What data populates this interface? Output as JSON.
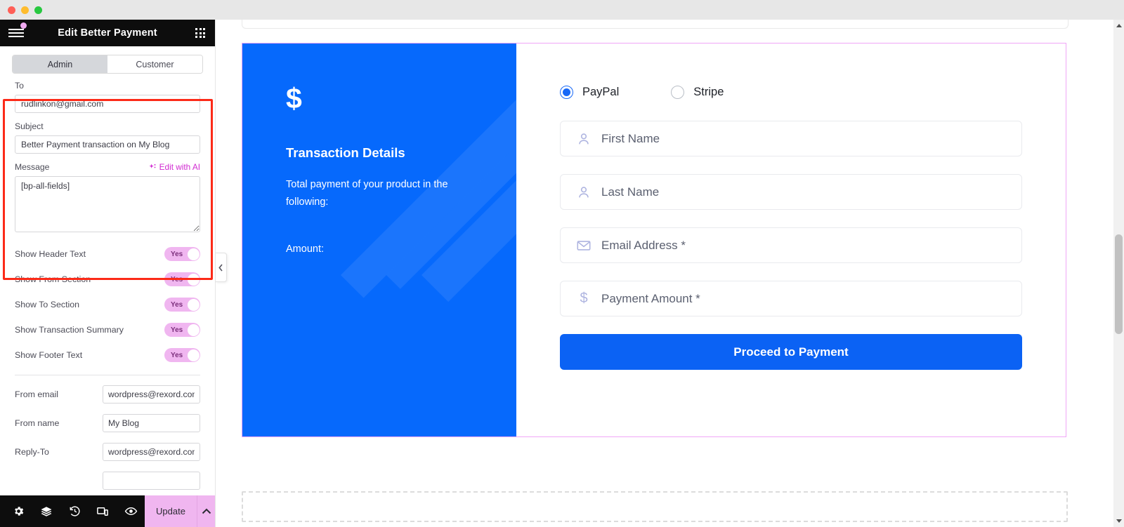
{
  "window": {
    "traffic_lights": [
      "close",
      "minimize",
      "maximize"
    ]
  },
  "panel": {
    "title": "Edit Better Payment",
    "menu_icon": "hamburger-menu-icon",
    "apps_icon": "grid-apps-icon",
    "tabs": [
      {
        "label": "Admin",
        "active": true
      },
      {
        "label": "Customer",
        "active": false
      }
    ],
    "email_fields": {
      "to_label": "To",
      "to_value": "rudlinkon@gmail.com",
      "subject_label": "Subject",
      "subject_value": "Better Payment transaction on My Blog",
      "message_label": "Message",
      "ai_link": "Edit with AI",
      "message_value": "[bp-all-fields]"
    },
    "toggles": [
      {
        "label": "Show Header Text",
        "state": "Yes"
      },
      {
        "label": "Show From Section",
        "state": "Yes"
      },
      {
        "label": "Show To Section",
        "state": "Yes"
      },
      {
        "label": "Show Transaction Summary",
        "state": "Yes"
      },
      {
        "label": "Show Footer Text",
        "state": "Yes"
      }
    ],
    "sender_fields": [
      {
        "label": "From email",
        "value": "wordpress@rexord.con"
      },
      {
        "label": "From name",
        "value": "My Blog"
      },
      {
        "label": "Reply-To",
        "value": "wordpress@rexord.con"
      }
    ],
    "bottom_bar": {
      "icons": [
        "settings-gear-icon",
        "layers-icon",
        "history-icon",
        "responsive-mode-icon",
        "preview-eye-icon"
      ],
      "update_label": "Update",
      "caret_icon": "chevron-up-icon"
    },
    "collapse_handle_icon": "chevron-left-icon"
  },
  "canvas": {
    "transaction_panel": {
      "currency_icon": "dollar-sign-icon",
      "heading": "Transaction Details",
      "description": "Total payment of your product in the following:",
      "amount_label": "Amount:"
    },
    "payment_form": {
      "methods": [
        {
          "label": "PayPal",
          "selected": true
        },
        {
          "label": "Stripe",
          "selected": false
        }
      ],
      "inputs": [
        {
          "placeholder": "First Name",
          "icon": "user-icon",
          "value": ""
        },
        {
          "placeholder": "Last Name",
          "icon": "user-icon",
          "value": ""
        },
        {
          "placeholder": "Email Address *",
          "icon": "envelope-icon",
          "value": ""
        },
        {
          "placeholder": "Payment Amount *",
          "icon": "dollar-sign-icon",
          "value": ""
        }
      ],
      "submit_label": "Proceed to Payment"
    }
  },
  "colors": {
    "accent_blue": "#0669fc",
    "button_blue": "#0b62f4",
    "toggle_pink": "#f0b6f0",
    "highlight_red": "#fc2a18",
    "widget_outline": "#f0a6f7",
    "ai_magenta": "#d12ad1"
  }
}
